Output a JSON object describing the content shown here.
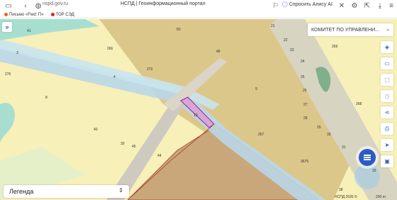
{
  "browser": {
    "url": "nspd.gov.ru",
    "title": "НСПД | Геоинформационный портал",
    "alice": "Спросить Алису AI"
  },
  "bookmarks": [
    {
      "label": "Письмо «Fwd: П»",
      "color": "#e8641c"
    },
    {
      "label": "ТОР СЭД",
      "color": "#d9251c"
    }
  ],
  "map": {
    "committee_select": "КОМИТЕТ ПО УПРАВЛЕНИ...",
    "legend_label": "Легенда",
    "copyright": "НСПД 2026 ©",
    "scale": "200 m",
    "parcel_labels": [
      {
        "text": "41"
      },
      {
        "text": "3"
      },
      {
        "text": "276"
      },
      {
        "text": "266"
      },
      {
        "text": "4"
      },
      {
        "text": "8"
      },
      {
        "text": "273"
      },
      {
        "text": "40"
      },
      {
        "text": "39"
      },
      {
        "text": "45"
      },
      {
        "text": "44"
      },
      {
        "text": "50"
      },
      {
        "text": "48"
      },
      {
        "text": "9"
      },
      {
        "text": "21"
      },
      {
        "text": "22"
      },
      {
        "text": "23"
      },
      {
        "text": "24"
      },
      {
        "text": "25"
      },
      {
        "text": "26"
      },
      {
        "text": "27"
      },
      {
        "text": "28"
      },
      {
        "text": "29"
      },
      {
        "text": "30"
      },
      {
        "text": "31"
      },
      {
        "text": "33"
      },
      {
        "text": "269"
      },
      {
        "text": "268"
      },
      {
        "text": "267"
      },
      {
        "text": "3675"
      },
      {
        "text": "38"
      },
      {
        "text": "10"
      }
    ]
  },
  "toolbar": [
    {
      "icon": "layers-icon"
    },
    {
      "icon": "ruler-icon"
    },
    {
      "icon": "select-area-icon"
    },
    {
      "icon": "history-icon"
    },
    {
      "icon": "share-icon"
    },
    {
      "icon": "print-icon"
    },
    {
      "icon": "location-icon"
    },
    {
      "icon": "minimap-icon"
    }
  ]
}
